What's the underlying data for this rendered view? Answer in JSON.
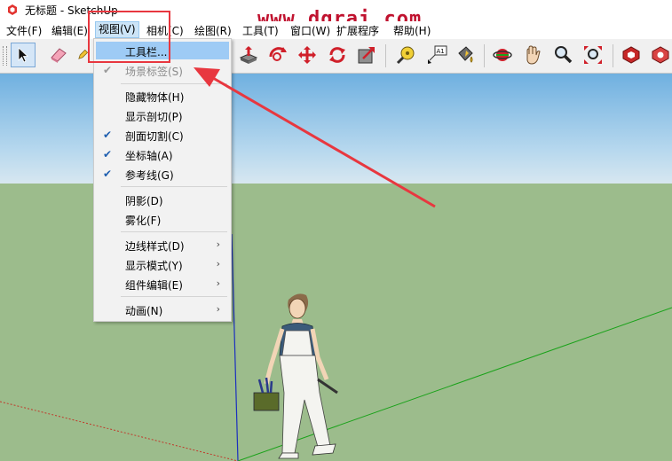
{
  "window": {
    "title": "无标题 - SketchUp",
    "watermark": "www.dgrai.com"
  },
  "menubar": [
    {
      "label": "文件(F)",
      "active": false
    },
    {
      "label": "编辑(E)",
      "active": false
    },
    {
      "label": "视图(V)",
      "active": true
    },
    {
      "label": "相机(C)",
      "active": false
    },
    {
      "label": "绘图(R)",
      "active": false
    },
    {
      "label": "工具(T)",
      "active": false
    },
    {
      "label": "窗口(W)",
      "active": false
    },
    {
      "label": "扩展程序",
      "active": false
    },
    {
      "label": "帮助(H)",
      "active": false
    }
  ],
  "toolbar": {
    "tools": [
      {
        "name": "select-tool-icon",
        "selected": true
      },
      {
        "name": "eraser-tool-icon"
      },
      {
        "name": "pencil-tool-icon"
      },
      {
        "name": "push-pull-tool-icon"
      },
      {
        "name": "follow-me-tool-icon"
      },
      {
        "name": "move-tool-icon"
      },
      {
        "name": "rotate-tool-icon"
      },
      {
        "name": "scale-tool-icon"
      },
      {
        "name": "tape-measure-tool-icon"
      },
      {
        "name": "text-tool-icon",
        "text": "A1"
      },
      {
        "name": "paint-bucket-tool-icon"
      },
      {
        "name": "orbit-tool-icon"
      },
      {
        "name": "pan-tool-icon"
      },
      {
        "name": "zoom-tool-icon"
      },
      {
        "name": "zoom-extents-tool-icon"
      },
      {
        "name": "3d-warehouse-icon"
      },
      {
        "name": "extension-warehouse-icon"
      }
    ]
  },
  "view_menu": {
    "items": [
      {
        "label": "工具栏...",
        "checked": false,
        "disabled": false,
        "highlight": true,
        "submenu": false
      },
      {
        "label": "场景标签(S)",
        "checked": true,
        "disabled": true,
        "highlight": false,
        "submenu": false
      },
      {
        "label": "隐藏物体(H)",
        "checked": false,
        "disabled": false,
        "highlight": false,
        "submenu": false
      },
      {
        "label": "显示剖切(P)",
        "checked": false,
        "disabled": false,
        "highlight": false,
        "submenu": false
      },
      {
        "label": "剖面切割(C)",
        "checked": true,
        "disabled": false,
        "highlight": false,
        "submenu": false
      },
      {
        "label": "坐标轴(A)",
        "checked": true,
        "disabled": false,
        "highlight": false,
        "submenu": false
      },
      {
        "label": "参考线(G)",
        "checked": true,
        "disabled": false,
        "highlight": false,
        "submenu": false
      },
      {
        "label": "阴影(D)",
        "checked": false,
        "disabled": false,
        "highlight": false,
        "submenu": false
      },
      {
        "label": "雾化(F)",
        "checked": false,
        "disabled": false,
        "highlight": false,
        "submenu": false
      },
      {
        "label": "边线样式(D)",
        "checked": false,
        "disabled": false,
        "highlight": false,
        "submenu": true
      },
      {
        "label": "显示模式(Y)",
        "checked": false,
        "disabled": false,
        "highlight": false,
        "submenu": true
      },
      {
        "label": "组件编辑(E)",
        "checked": false,
        "disabled": false,
        "highlight": false,
        "submenu": true
      },
      {
        "label": "动画(N)",
        "checked": false,
        "disabled": false,
        "highlight": false,
        "submenu": true
      }
    ],
    "check_glyph": "✔",
    "submenu_glyph": "›"
  },
  "colors": {
    "annotation": "#e8373f",
    "sky": "#8cc3e8",
    "ground": "#9cbc8c",
    "menu_highlight": "#9ecbf5",
    "axis_red": "#c0392b",
    "axis_green": "#1aa21a",
    "axis_blue": "#1b2fbf"
  }
}
